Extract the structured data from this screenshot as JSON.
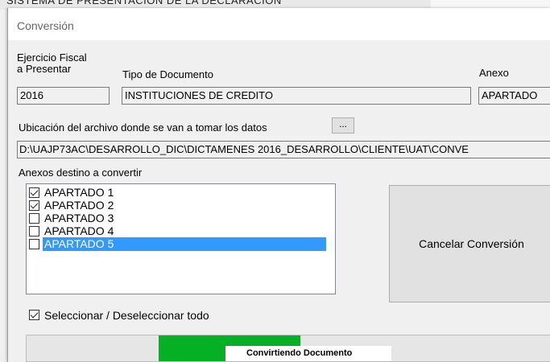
{
  "background_app": {
    "title_fragment": "SISTEMA DE PRESENTACION DE LA DECLARACION"
  },
  "window": {
    "title": "Conversión"
  },
  "form": {
    "ejercicio_label_line1": "Ejercicio Fiscal",
    "ejercicio_label_line2": "a Presentar",
    "ejercicio_value": "2016",
    "tipo_label": "Tipo de Documento",
    "tipo_value": "INSTITUCIONES DE CREDITO",
    "anexo_label": "Anexo",
    "anexo_value": "APARTADO",
    "ubicacion_label": "Ubicación del archivo donde se van a tomar los datos",
    "browse_label": "...",
    "path_value": "D:\\UAJP73AC\\DESARROLLO_DIC\\DICTAMENES 2016_DESARROLLO\\CLIENTE\\UAT\\CONVE",
    "anexos_label": "Anexos destino a convertir"
  },
  "anexos": [
    {
      "label": "APARTADO 1",
      "checked": true,
      "selected": false
    },
    {
      "label": "APARTADO 2",
      "checked": true,
      "selected": false
    },
    {
      "label": "APARTADO 3",
      "checked": false,
      "selected": false
    },
    {
      "label": "APARTADO 4",
      "checked": false,
      "selected": false
    },
    {
      "label": "APARTADO 5",
      "checked": false,
      "selected": true
    }
  ],
  "cancel_button": "Cancelar Conversión",
  "select_all": {
    "label": "Seleccionar / Deseleccionar todo",
    "checked": true
  },
  "progress": {
    "label": "Convirtiendo Documento",
    "fraction": 0.27,
    "fill_color": "#06b025"
  },
  "colors": {
    "selection": "#3399ff",
    "progress": "#06b025"
  }
}
